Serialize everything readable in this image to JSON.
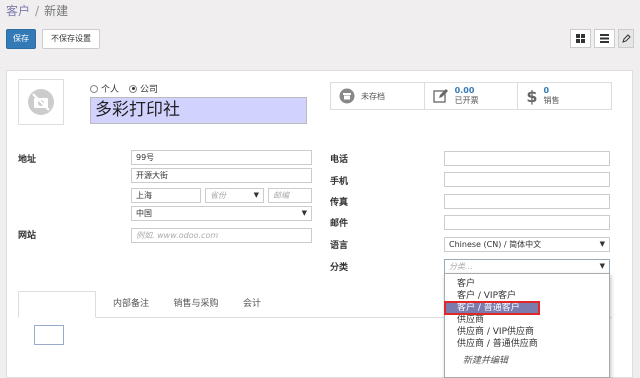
{
  "breadcrumb": {
    "parent": "客户",
    "separator": "/",
    "current": "新建"
  },
  "toolbar": {
    "save": "保存",
    "discard": "不保存设置"
  },
  "colors": {
    "primary": "#337ab7",
    "name_bg": "#d2d2ff",
    "highlight": "#7c7bad",
    "selection_border": "#e02828"
  },
  "form": {
    "company_type": {
      "person": "个人",
      "company": "公司",
      "selected": "company"
    },
    "name": "多彩打印社",
    "stats": [
      {
        "icon": "archive-icon",
        "value": "",
        "label": "未存档"
      },
      {
        "icon": "edit-icon",
        "value": "0.00",
        "label": "已开票"
      },
      {
        "icon": "dollar-icon",
        "value": "0",
        "label": "销售"
      }
    ],
    "address_label": "地址",
    "website_label": "网站",
    "street": "99号",
    "street2": "开源大街",
    "city": "上海",
    "state_placeholder": "省份",
    "zip_placeholder": "邮编",
    "country": "中国",
    "website_placeholder": "例如. www.odoo.com",
    "phone_label": "电话",
    "mobile_label": "手机",
    "fax_label": "传真",
    "email_label": "邮件",
    "language_label": "语言",
    "language_value": "Chinese (CN) / 简体中文",
    "category_label": "分类",
    "category_placeholder": "分类..."
  },
  "tabs": [
    "",
    "内部备注",
    "销售与采购",
    "会计"
  ],
  "dropdown": {
    "items": [
      "客户",
      "客户 / VIP客户",
      "客户 / 普通客户",
      "供应商",
      "供应商 / VIP供应商",
      "供应商 / 普通供应商"
    ],
    "selected_index": 2,
    "create_label": "新建并编辑"
  }
}
